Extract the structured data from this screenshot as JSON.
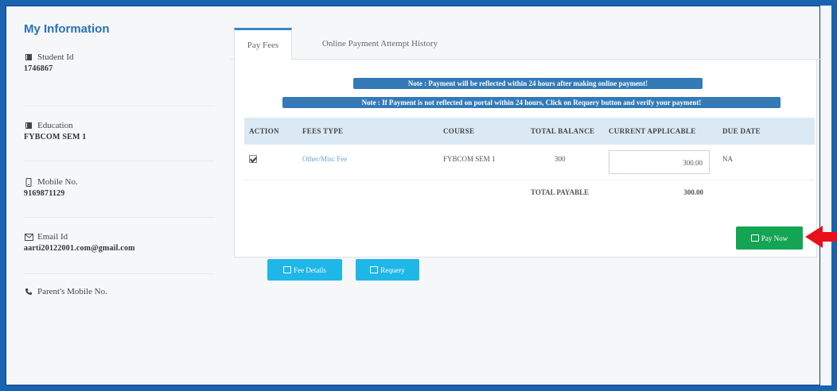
{
  "info": {
    "title": "My Information",
    "items": [
      {
        "icon": "book-icon",
        "label": "Student Id",
        "value": "1746867"
      },
      {
        "icon": "book-icon",
        "label": "Education",
        "value": "FYBCOM SEM 1"
      },
      {
        "icon": "mobile-icon",
        "label": "Mobile No.",
        "value": "9169871129"
      },
      {
        "icon": "envelope-icon",
        "label": "Email Id",
        "value": "aarti20122001.com@gmail.com"
      },
      {
        "icon": "phone-icon",
        "label": "Parent's Mobile No.",
        "value": ""
      }
    ]
  },
  "tabs": {
    "pay_fees": "Pay Fees",
    "history": "Online Payment Attempt History"
  },
  "notes": {
    "note1": "Note : Payment will be reflected within 24 hours after making online payment!",
    "note2": "Note : If Payment is not reflected on portal within 24 hours, Click on Requery button and verify your payment!"
  },
  "table": {
    "headers": {
      "action": "ACTION",
      "fees_type": "FEES TYPE",
      "course": "COURSE",
      "total_balance": "TOTAL BALANCE",
      "current_applicable": "CURRENT APPLICABLE",
      "due_date": "DUE DATE"
    },
    "row": {
      "checked": true,
      "fees_type": "Other/Misc Fee",
      "course": "FYBCOM SEM 1",
      "total_balance": "300",
      "current_applicable": "300.00",
      "due_date": "NA"
    },
    "total_label": "TOTAL PAYABLE",
    "total_value": "300.00"
  },
  "buttons": {
    "fee_details": "Fee Details",
    "requery": "Requery",
    "pay_now": "Pay Now"
  },
  "colors": {
    "frame": "#1a63b0",
    "accent": "#337ab7",
    "info_button": "#1fb6e8",
    "pay_button": "#13a454",
    "arrow": "#e8101b"
  }
}
